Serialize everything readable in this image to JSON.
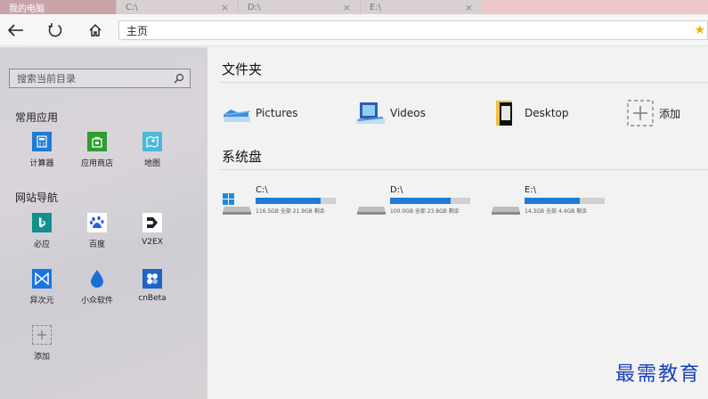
{
  "tabs": [
    {
      "label": "我的电脑",
      "active": true
    },
    {
      "label": "C:\\",
      "active": false
    },
    {
      "label": "D:\\",
      "active": false
    },
    {
      "label": "E:\\",
      "active": false
    }
  ],
  "tab_close": "×",
  "address": {
    "value": "主页",
    "star": "★"
  },
  "sidebar": {
    "search_placeholder": "搜索当前目录",
    "common_apps_title": "常用应用",
    "common_apps": [
      {
        "label": "计算器",
        "icon": "calculator-icon",
        "color": "#1e7bd6"
      },
      {
        "label": "应用商店",
        "icon": "store-icon",
        "color": "#2e9e2e"
      },
      {
        "label": "地图",
        "icon": "map-icon",
        "color": "#4db8d8"
      }
    ],
    "sites_title": "网站导航",
    "sites": [
      {
        "label": "必应",
        "icon": "bing-icon",
        "color": "#138f8f"
      },
      {
        "label": "百度",
        "icon": "baidu-icon",
        "color": "#2a5fe0"
      },
      {
        "label": "V2EX",
        "icon": "v2ex-icon",
        "color": "#222222"
      },
      {
        "label": "异次元",
        "icon": "iplaysoft-icon",
        "color": "#1a73e0"
      },
      {
        "label": "小众软件",
        "icon": "appinn-icon",
        "color": "#1a6ed8"
      },
      {
        "label": "cnBeta",
        "icon": "cnbeta-icon",
        "color": "#1f63c9"
      }
    ],
    "add_label": "添加"
  },
  "main": {
    "folders_title": "文件夹",
    "folders": [
      {
        "label": "Pictures",
        "icon": "pictures-folder-icon"
      },
      {
        "label": "Videos",
        "icon": "videos-folder-icon"
      },
      {
        "label": "Desktop",
        "icon": "desktop-folder-icon"
      },
      {
        "label": "添加",
        "icon": "add-icon"
      }
    ],
    "drives_title": "系统盘",
    "drives": [
      {
        "label": "C:\\",
        "info": "116.5GB 全部  21.9GB 剩余",
        "used_fraction": 0.81,
        "system": true
      },
      {
        "label": "D:\\",
        "info": "100.0GB 全部  23.8GB 剩余",
        "used_fraction": 0.76,
        "system": false
      },
      {
        "label": "E:\\",
        "info": "14.3GB 全部  4.4GB 剩余",
        "used_fraction": 0.69,
        "system": false
      }
    ]
  },
  "watermark": "最需教育",
  "colors": {
    "accent": "#1e7bd6",
    "star": "#f0b400",
    "watermark": "#1840b8"
  }
}
